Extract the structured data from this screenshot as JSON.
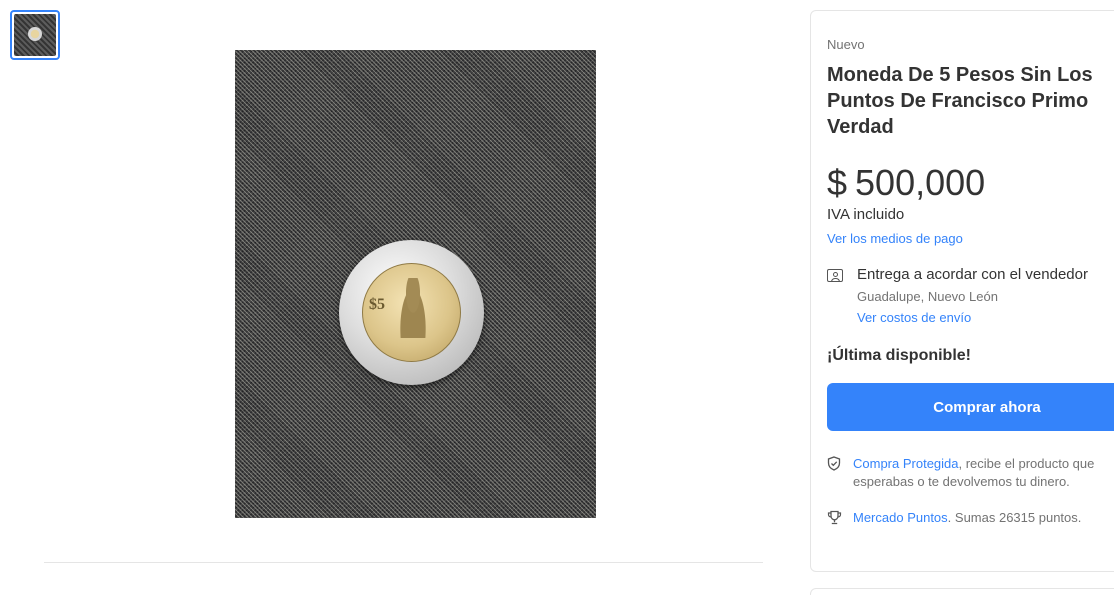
{
  "gallery": {
    "thumbnails": [
      {
        "alt": "coin-photo-thumbnail"
      }
    ]
  },
  "product": {
    "condition": "Nuevo",
    "title": "Moneda De 5 Pesos Sin Los Puntos De Francisco Primo Verdad",
    "price_currency": "$",
    "price_amount": "500,000",
    "tax_note": "IVA incluido",
    "payment_link": "Ver los medios de pago",
    "delivery": {
      "text": "Entrega a acordar con el vendedor",
      "location": "Guadalupe, Nuevo León",
      "shipping_link": "Ver costos de envío"
    },
    "stock_note": "¡Última disponible!",
    "buy_button": "Comprar ahora",
    "benefits": [
      {
        "link": "Compra Protegida",
        "text": ", recibe el producto que esperabas o te devolvemos tu dinero.",
        "icon": "shield-check-icon"
      },
      {
        "link": "Mercado Puntos",
        "text": ". Sumas 26315 puntos.",
        "icon": "trophy-icon"
      }
    ]
  },
  "colors": {
    "accent": "#3483fa",
    "text_primary": "#333333",
    "text_secondary": "#737373"
  }
}
